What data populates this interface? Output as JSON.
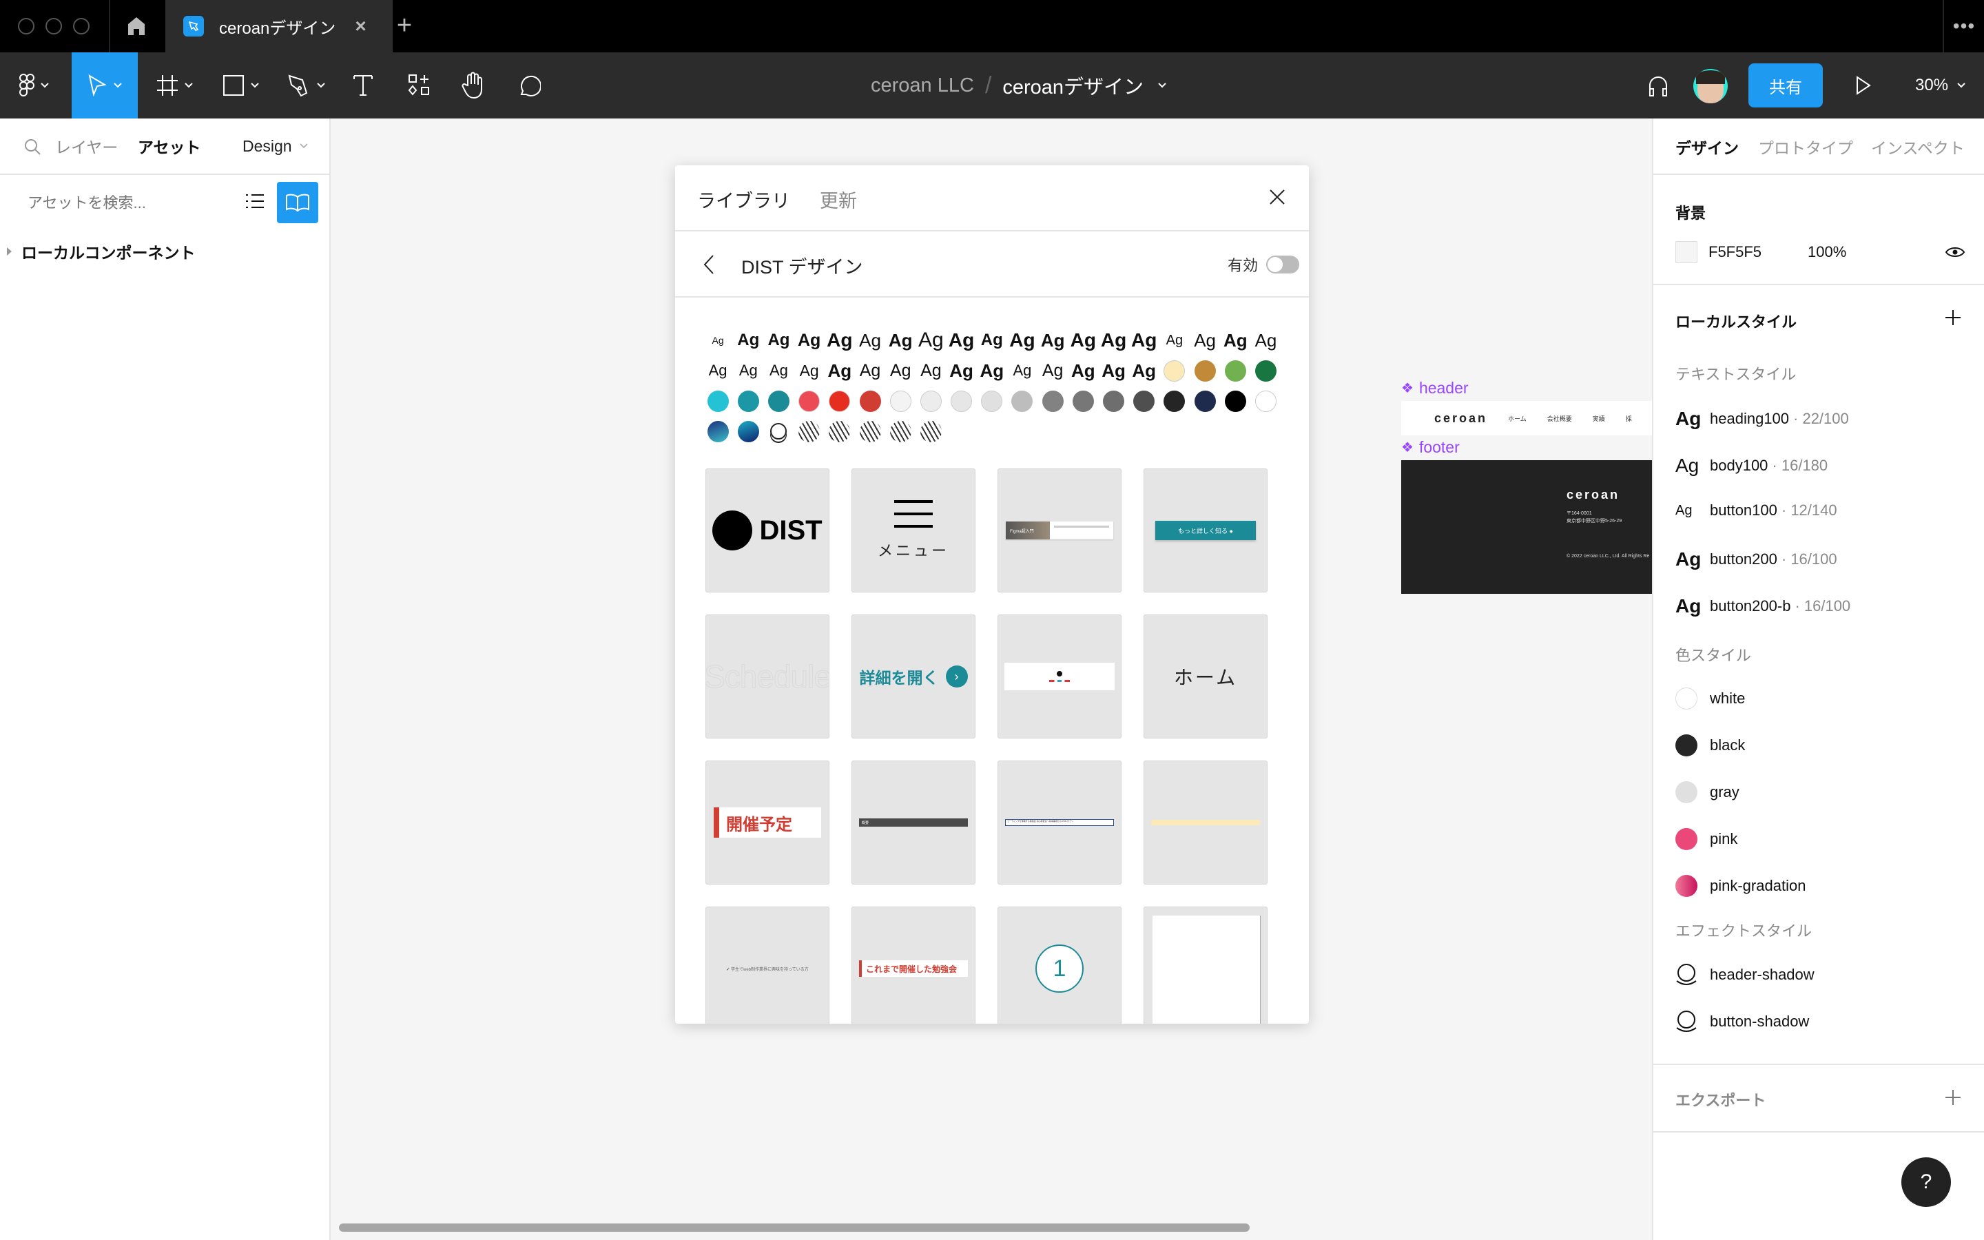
{
  "titlebar": {
    "tab_title": "ceroanデザイン",
    "close_glyph": "×",
    "new_tab_glyph": "+",
    "more_glyph": "•••"
  },
  "toolbar": {
    "tools": [
      {
        "name": "main-menu",
        "icon": "figma-logo-icon",
        "has_dropdown": true
      },
      {
        "name": "move",
        "icon": "cursor-arrow-icon",
        "has_dropdown": true,
        "active": true
      },
      {
        "name": "frame",
        "icon": "frame-hash-icon",
        "has_dropdown": true
      },
      {
        "name": "shape",
        "icon": "rectangle-icon",
        "has_dropdown": true
      },
      {
        "name": "pen",
        "icon": "pen-nib-icon",
        "has_dropdown": true
      },
      {
        "name": "text",
        "icon": "text-t-icon",
        "has_dropdown": false
      },
      {
        "name": "resources",
        "icon": "components-resources-icon",
        "has_dropdown": false
      },
      {
        "name": "hand",
        "icon": "hand-icon",
        "has_dropdown": false
      },
      {
        "name": "comment",
        "icon": "speech-bubble-icon",
        "has_dropdown": false
      }
    ],
    "breadcrumb_team": "ceroan LLC",
    "breadcrumb_separator": "/",
    "breadcrumb_file": "ceroanデザイン",
    "share_label": "共有",
    "zoom_level": "30%",
    "accent_color": "#1e9bf0"
  },
  "left_panel": {
    "tabs": [
      {
        "label": "レイヤー",
        "active": false
      },
      {
        "label": "アセット",
        "active": true
      }
    ],
    "page_selector": "Design",
    "search_placeholder": "アセットを検索...",
    "section_label": "ローカルコンポーネント"
  },
  "library_modal": {
    "tabs": [
      {
        "label": "ライブラリ",
        "active": true
      },
      {
        "label": "更新",
        "active": false
      }
    ],
    "library_name": "DIST デザイン",
    "enable_label": "有効",
    "enabled": false,
    "text_style_samples": [
      {
        "label": "Ag",
        "size": 14,
        "weight": "normal"
      },
      {
        "label": "Ag",
        "size": 24,
        "weight": "bold"
      },
      {
        "label": "Ag",
        "size": 24,
        "weight": "bold"
      },
      {
        "label": "Ag",
        "size": 25,
        "weight": "bold"
      },
      {
        "label": "Ag",
        "size": 28,
        "weight": "900"
      },
      {
        "label": "Ag",
        "size": 26,
        "weight": "normal"
      },
      {
        "label": "Ag",
        "size": 26,
        "weight": "bold"
      },
      {
        "label": "Ag",
        "size": 30,
        "weight": "200"
      },
      {
        "label": "Ag",
        "size": 28,
        "weight": "900"
      },
      {
        "label": "Ag",
        "size": 24,
        "weight": "bold"
      },
      {
        "label": "Ag",
        "size": 28,
        "weight": "900"
      },
      {
        "label": "Ag",
        "size": 26,
        "weight": "bold"
      },
      {
        "label": "Ag",
        "size": 28,
        "weight": "bold"
      },
      {
        "label": "Ag",
        "size": 28,
        "weight": "bold"
      },
      {
        "label": "Ag",
        "size": 28,
        "weight": "bold"
      },
      {
        "label": "Ag",
        "size": 20,
        "weight": "normal"
      },
      {
        "label": "Ag",
        "size": 26,
        "weight": "normal"
      },
      {
        "label": "Ag",
        "size": 26,
        "weight": "bold"
      },
      {
        "label": "Ag",
        "size": 26,
        "weight": "normal"
      },
      {
        "label": "Ag",
        "size": 22,
        "weight": "normal"
      },
      {
        "label": "Ag",
        "size": 22,
        "weight": "normal"
      },
      {
        "label": "Ag",
        "size": 22,
        "weight": "normal"
      },
      {
        "label": "Ag",
        "size": 23,
        "weight": "normal"
      },
      {
        "label": "Ag",
        "size": 26,
        "weight": "900"
      },
      {
        "label": "Ag",
        "size": 25,
        "weight": "normal"
      },
      {
        "label": "Ag",
        "size": 25,
        "weight": "normal"
      },
      {
        "label": "Ag",
        "size": 25,
        "weight": "normal"
      },
      {
        "label": "Ag",
        "size": 26,
        "weight": "900"
      },
      {
        "label": "Ag",
        "size": 26,
        "weight": "bold"
      },
      {
        "label": "Ag",
        "size": 22,
        "weight": "normal"
      },
      {
        "label": "Ag",
        "size": 25,
        "weight": "normal"
      },
      {
        "label": "Ag",
        "size": 26,
        "weight": "bold"
      },
      {
        "label": "Ag",
        "size": 26,
        "weight": "bold"
      },
      {
        "label": "Ag",
        "size": 26,
        "weight": "bold"
      }
    ],
    "color_style_samples": [
      {
        "type": "solid",
        "color": "#fbe9b7"
      },
      {
        "type": "solid",
        "color": "#c08a38"
      },
      {
        "type": "solid",
        "color": "#72b150"
      },
      {
        "type": "solid",
        "color": "#187640"
      },
      {
        "type": "solid",
        "color": "#25c2d6"
      },
      {
        "type": "solid",
        "color": "#1b97a5"
      },
      {
        "type": "solid",
        "color": "#1b8b98"
      },
      {
        "type": "solid",
        "color": "#ec4a55"
      },
      {
        "type": "solid",
        "color": "#e52e20"
      },
      {
        "type": "solid",
        "color": "#d03e33"
      },
      {
        "type": "solid",
        "color": "#f3f3f3"
      },
      {
        "type": "solid",
        "color": "#ececec"
      },
      {
        "type": "solid",
        "color": "#e6e6e6"
      },
      {
        "type": "solid",
        "color": "#e0e0e0"
      },
      {
        "type": "solid",
        "color": "#bdbdbd"
      },
      {
        "type": "solid",
        "color": "#828282"
      },
      {
        "type": "solid",
        "color": "#777777"
      },
      {
        "type": "solid",
        "color": "#6e6e6e"
      },
      {
        "type": "solid",
        "color": "#4f4f4f"
      },
      {
        "type": "solid",
        "color": "#252525"
      },
      {
        "type": "solid",
        "color": "#1e2b4d"
      },
      {
        "type": "solid",
        "color": "#000000"
      },
      {
        "type": "solid",
        "color": "#ffffff"
      },
      {
        "type": "gradient",
        "from": "#1d2f7f",
        "to": "#3cc0c8"
      },
      {
        "type": "gradient",
        "from": "#1bb0c6",
        "to": "#0e1f6e"
      },
      {
        "type": "effect"
      },
      {
        "type": "pattern"
      },
      {
        "type": "pattern"
      },
      {
        "type": "pattern"
      },
      {
        "type": "pattern"
      },
      {
        "type": "pattern"
      }
    ],
    "components": [
      {
        "kind": "logo",
        "text": "DIST"
      },
      {
        "kind": "menu",
        "text": "メニュー"
      },
      {
        "kind": "article-card",
        "text": "Figma超入門"
      },
      {
        "kind": "button-teal",
        "text": "もっと詳しく知る"
      },
      {
        "kind": "outline-heading",
        "text": "Schedule"
      },
      {
        "kind": "link-button",
        "text": "詳細を開く"
      },
      {
        "kind": "profile-card",
        "text": ""
      },
      {
        "kind": "nav-item",
        "text": "ホーム"
      },
      {
        "kind": "red-heading",
        "text": "開催予定"
      },
      {
        "kind": "dark-bar",
        "text": "概要"
      },
      {
        "kind": "input-box",
        "text": "コーディングを体験する勉強会 初心者歓迎〜基本事項からHTMLまで〜"
      },
      {
        "kind": "notice-bar",
        "text": ""
      },
      {
        "kind": "check-item",
        "text": "学生でweb制作業界に興味を持っている方"
      },
      {
        "kind": "red-heading-small",
        "text": "これまで開催した勉強会"
      },
      {
        "kind": "step-number",
        "text": "1"
      },
      {
        "kind": "blank-page",
        "text": ""
      }
    ]
  },
  "canvas": {
    "frames": [
      {
        "label": "header",
        "nav": [
          "ホーム",
          "会社概要",
          "実績",
          "採"
        ],
        "logo": "ceroan"
      },
      {
        "label": "footer",
        "logo": "ceroan",
        "address": "〒164-0001\n東京都中野区中野5-26-29",
        "copyright": "© 2022 ceroan LLC., Ltd. All Rights Re"
      }
    ],
    "component_color": "#9747ff"
  },
  "right_panel": {
    "tabs": [
      {
        "label": "デザイン",
        "active": true
      },
      {
        "label": "プロトタイプ",
        "active": false
      },
      {
        "label": "インスペクト",
        "active": false
      }
    ],
    "background": {
      "title": "背景",
      "hex": "F5F5F5",
      "opacity": "100%"
    },
    "local_styles_title": "ローカルスタイル",
    "text_styles": {
      "title": "テキストスタイル",
      "items": [
        {
          "name": "heading100",
          "meta": "22/100",
          "weight": "bold",
          "size": 28
        },
        {
          "name": "body100",
          "meta": "16/180",
          "weight": "normal",
          "size": 28
        },
        {
          "name": "button100",
          "meta": "12/140",
          "weight": "normal",
          "size": 20
        },
        {
          "name": "button200",
          "meta": "16/100",
          "weight": "bold",
          "size": 28
        },
        {
          "name": "button200-b",
          "meta": "16/100",
          "weight": "bold",
          "size": 28
        }
      ]
    },
    "color_styles": {
      "title": "色スタイル",
      "items": [
        {
          "name": "white",
          "color": "#ffffff"
        },
        {
          "name": "black",
          "color": "#262626"
        },
        {
          "name": "gray",
          "color": "#e0e0e0"
        },
        {
          "name": "pink",
          "color": "#eb487a"
        },
        {
          "name": "pink-gradation",
          "from": "#f27a9a",
          "to": "#c7145e"
        }
      ]
    },
    "effect_styles": {
      "title": "エフェクトスタイル",
      "items": [
        {
          "name": "header-shadow"
        },
        {
          "name": "button-shadow"
        }
      ]
    },
    "export_title": "エクスポート",
    "help_label": "?"
  }
}
